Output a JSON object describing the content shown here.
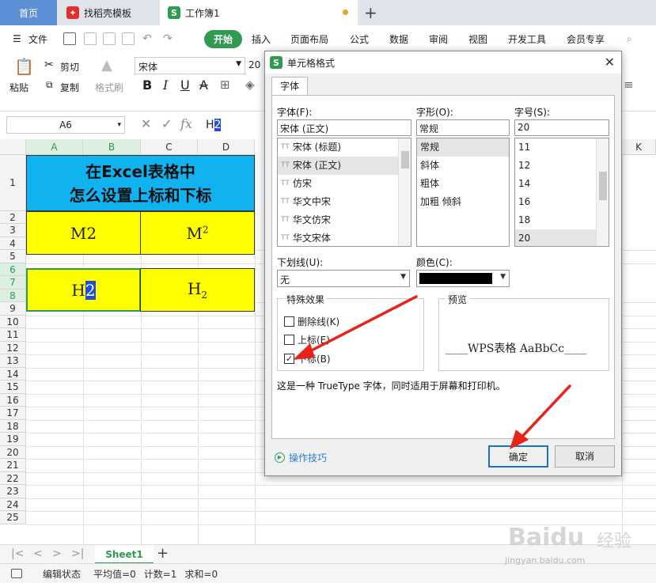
{
  "tabs": {
    "home": "首页",
    "template": "找稻壳模板",
    "workbook": "工作簿1",
    "new_tab": "+"
  },
  "menu": {
    "file": "文件",
    "start": "开始",
    "insert": "插入",
    "page_layout": "页面布局",
    "formula": "公式",
    "data": "数据",
    "review": "审阅",
    "view": "视图",
    "dev_tools": "开发工具",
    "member": "会员专享"
  },
  "toolbar": {
    "cut": "剪切",
    "paste": "粘贴",
    "copy": "复制",
    "format_painter": "格式刷",
    "font_name": "宋体",
    "font_size": "20",
    "bold": "B",
    "italic": "I",
    "underline": "U",
    "strike": "A"
  },
  "formula_bar": {
    "name_box": "A6",
    "fx": "fx",
    "content_prefix": "H",
    "content_selected": "2"
  },
  "grid": {
    "columns": [
      "A",
      "B",
      "C",
      "D",
      "K"
    ],
    "rows": [
      "1",
      "2",
      "3",
      "4",
      "5",
      "6",
      "7",
      "8",
      "9",
      "10",
      "11",
      "12",
      "13",
      "14",
      "15",
      "16",
      "17",
      "18",
      "19",
      "20",
      "21",
      "22",
      "23",
      "24",
      "25"
    ],
    "title_line1": "在Excel表格中",
    "title_line2": "怎么设置上标和下标",
    "m2_plain": "M2",
    "m2_sup_base": "M",
    "m2_sup_exp": "2",
    "h2_base": "H",
    "h2_selected": "2",
    "h2_sub_base": "H",
    "h2_sub_idx": "2"
  },
  "sheet": {
    "name": "Sheet1",
    "add": "+"
  },
  "status": {
    "mode": "编辑状态",
    "average": "平均值=0",
    "count": "计数=1",
    "sum": "求和=0"
  },
  "dialog": {
    "title": "单元格格式",
    "tab_font": "字体",
    "font_label": "字体(F):",
    "font_value": "宋体 (正文)",
    "font_list": [
      "宋体 (标题)",
      "宋体 (正文)",
      "仿宋",
      "华文中宋",
      "华文仿宋",
      "华文宋体"
    ],
    "style_label": "字形(O):",
    "style_value": "常规",
    "style_list": [
      "常规",
      "斜体",
      "粗体",
      "加粗 倾斜"
    ],
    "size_label": "字号(S):",
    "size_value": "20",
    "size_list": [
      "11",
      "12",
      "14",
      "16",
      "18",
      "20"
    ],
    "underline_label": "下划线(U):",
    "underline_value": "无",
    "color_label": "颜色(C):",
    "color_value": "#000000",
    "effects_title": "特殊效果",
    "strikethrough": "删除线(K)",
    "superscript": "上标(E)",
    "subscript": "下标(B)",
    "subscript_checked": true,
    "preview_title": "预览",
    "preview_text": "____WPS表格  AaBbCc____",
    "description": "这是一种 TrueType 字体，同时适用于屏幕和打印机。",
    "tips": "操作技巧",
    "ok": "确定",
    "cancel": "取消"
  },
  "watermark": {
    "brand": "Baidu",
    "product": "经验",
    "url": "jingyan.baidu.com"
  },
  "colors": {
    "accent_green": "#2f9a50",
    "title_blue": "#10b3ef",
    "cell_yellow": "#ffff00",
    "selection_blue": "#1f4fd6",
    "arrow_red": "#e8241a"
  }
}
